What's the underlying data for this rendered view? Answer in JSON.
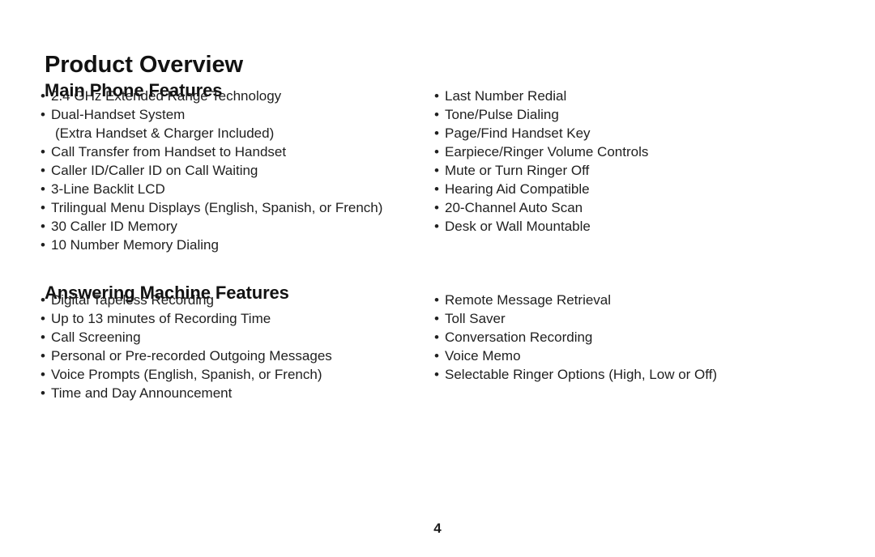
{
  "document": {
    "page_title": "Product Overview",
    "page_number": "4",
    "text_color": "#1f1f1f",
    "background_color": "#ffffff",
    "bullet_glyph": "•"
  },
  "sections": [
    {
      "heading": "Main Phone Features",
      "left_column": [
        {
          "bullet": "•",
          "text": "2.4 GHz Extended Range Technology",
          "continuation": false
        },
        {
          "bullet": "•",
          "text": "Dual-Handset System",
          "continuation": false
        },
        {
          "bullet": "",
          "text": "(Extra Handset & Charger Included)",
          "continuation": true
        },
        {
          "bullet": "•",
          "text": "Call Transfer from Handset to Handset",
          "continuation": false
        },
        {
          "bullet": "•",
          "text": "Caller ID/Caller ID on Call Waiting",
          "continuation": false
        },
        {
          "bullet": "•",
          "text": "3-Line Backlit LCD",
          "continuation": false
        },
        {
          "bullet": "•",
          "text": "Trilingual Menu Displays (English, Spanish, or French)",
          "continuation": false
        },
        {
          "bullet": "•",
          "text": "30 Caller ID Memory",
          "continuation": false
        },
        {
          "bullet": "•",
          "text": "10 Number Memory Dialing",
          "continuation": false
        }
      ],
      "right_column": [
        {
          "bullet": "•",
          "text": "Last Number Redial",
          "continuation": false
        },
        {
          "bullet": "•",
          "text": "Tone/Pulse Dialing",
          "continuation": false
        },
        {
          "bullet": "•",
          "text": "Page/Find Handset Key",
          "continuation": false
        },
        {
          "bullet": "•",
          "text": "Earpiece/Ringer Volume Controls",
          "continuation": false
        },
        {
          "bullet": "•",
          "text": "Mute or Turn Ringer Off",
          "continuation": false
        },
        {
          "bullet": "•",
          "text": "Hearing Aid Compatible",
          "continuation": false
        },
        {
          "bullet": "•",
          "text": "20-Channel Auto Scan",
          "continuation": false
        },
        {
          "bullet": "•",
          "text": "Desk or Wall Mountable",
          "continuation": false
        }
      ]
    },
    {
      "heading": "Answering Machine Features",
      "left_column": [
        {
          "bullet": "•",
          "text": "Digital Tapeless Recording",
          "continuation": false
        },
        {
          "bullet": "•",
          "text": "Up to 13 minutes of Recording Time",
          "continuation": false
        },
        {
          "bullet": "•",
          "text": "Call Screening",
          "continuation": false
        },
        {
          "bullet": "•",
          "text": "Personal or Pre-recorded Outgoing Messages",
          "continuation": false
        },
        {
          "bullet": "•",
          "text": "Voice Prompts (English, Spanish, or French)",
          "continuation": false
        },
        {
          "bullet": "•",
          "text": "Time and Day Announcement",
          "continuation": false
        }
      ],
      "right_column": [
        {
          "bullet": "•",
          "text": "Remote Message Retrieval",
          "continuation": false
        },
        {
          "bullet": "•",
          "text": "Toll Saver",
          "continuation": false
        },
        {
          "bullet": "•",
          "text": "Conversation Recording",
          "continuation": false
        },
        {
          "bullet": "•",
          "text": "Voice Memo",
          "continuation": false
        },
        {
          "bullet": "•",
          "text": "Selectable Ringer Options (High, Low or Off)",
          "continuation": false
        }
      ]
    }
  ]
}
